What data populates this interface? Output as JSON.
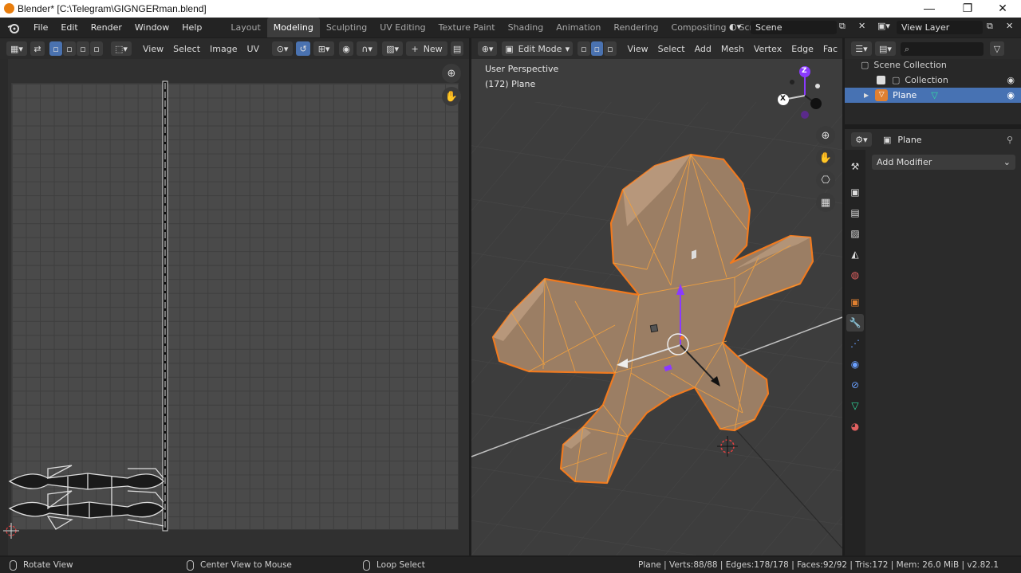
{
  "window": {
    "title": "Blender* [C:\\Telegram\\GIGNGERman.blend]",
    "controls": [
      "—",
      "❐",
      "✕"
    ]
  },
  "menu": [
    "File",
    "Edit",
    "Render",
    "Window",
    "Help"
  ],
  "workspaces": {
    "tabs": [
      "Layout",
      "Modeling",
      "Sculpting",
      "UV Editing",
      "Texture Paint",
      "Shading",
      "Animation",
      "Rendering",
      "Compositing",
      "Scripting"
    ],
    "active": "Modeling",
    "add": "+"
  },
  "scene": {
    "label": "Scene",
    "view_layer": "View Layer"
  },
  "uv_editor": {
    "menus": [
      "View",
      "Select",
      "Image",
      "UV"
    ],
    "new_button": "New",
    "new_plus": "+"
  },
  "viewport": {
    "mode": "Edit Mode",
    "menus": [
      "View",
      "Select",
      "Add",
      "Mesh",
      "Vertex",
      "Edge",
      "Fac"
    ],
    "overlay_view": "User Perspective",
    "overlay_object": "(172) Plane",
    "gizmo_axes": {
      "x": "X",
      "z": "Z"
    }
  },
  "outliner": {
    "root": "Scene Collection",
    "collection": "Collection",
    "object": "Plane"
  },
  "properties": {
    "object_name": "Plane",
    "add_modifier": "Add Modifier"
  },
  "statusbar": {
    "left": "Rotate View",
    "middle": "Center View to Mouse",
    "right": "Loop Select",
    "stats": "Plane | Verts:88/88 | Edges:178/178 | Faces:92/92 | Tris:172 | Mem: 26.0 MiB | v2.82.1"
  },
  "colors": {
    "selection_orange": "#f07a1f",
    "mesh_fill": "#9b7e64",
    "active_blue": "#4772b3",
    "axis_z": "#8a2be2",
    "axis_x": "#d0d0d0"
  },
  "icons": [
    "blender-logo-icon",
    "editor-type-icon",
    "zoom-icon",
    "hand-icon",
    "camera-icon",
    "grid-icon",
    "eye-icon",
    "mesh-icon",
    "wrench-icon",
    "scene-icon",
    "world-icon",
    "object-icon",
    "physics-icon",
    "constraint-icon",
    "data-icon",
    "material-icon",
    "pin-icon",
    "search-icon"
  ]
}
